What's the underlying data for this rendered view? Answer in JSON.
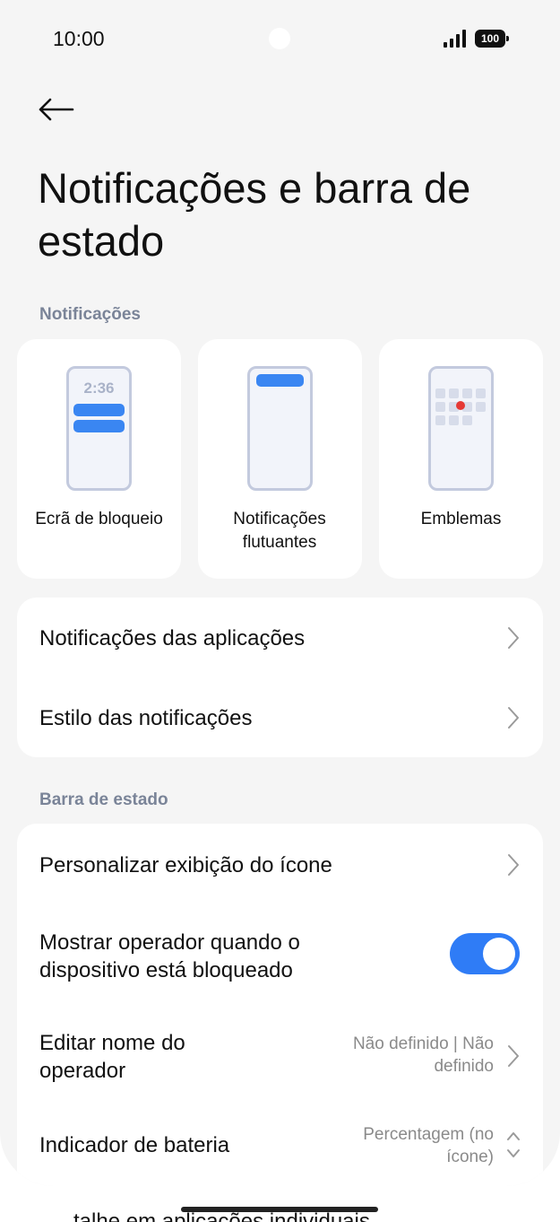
{
  "status_bar": {
    "time": "10:00",
    "battery": "100",
    "signal_icon": "signal-icon"
  },
  "header": {
    "back_icon": "arrow-left-icon",
    "title": "Notificações e barra de estado"
  },
  "notifications_section": {
    "label": "Notificações",
    "tiles": [
      {
        "label": "Ecrã de bloqueio",
        "clock": "2:36"
      },
      {
        "label": "Notificações flutuantes"
      },
      {
        "label": "Emblemas"
      }
    ],
    "rows": [
      {
        "title": "Notificações das aplicações"
      },
      {
        "title": "Estilo das notificações"
      }
    ]
  },
  "status_bar_section": {
    "label": "Barra de estado",
    "rows": [
      {
        "title": "Personalizar exibição do ícone"
      },
      {
        "title": "Mostrar operador quando o dispositivo está bloqueado",
        "toggle_on": true
      },
      {
        "title": "Editar nome do operador",
        "value": "Não definido | Não definido"
      },
      {
        "title": "Indicador de bateria",
        "value": "Percentagem (no ícone)"
      }
    ]
  },
  "peek_text": "...talhe em aplicações individuais",
  "colors": {
    "accent": "#2f7cf6",
    "background": "#f5f5f5",
    "card": "#ffffff",
    "section_label": "#7a8498",
    "badge_dot": "#e53935"
  }
}
